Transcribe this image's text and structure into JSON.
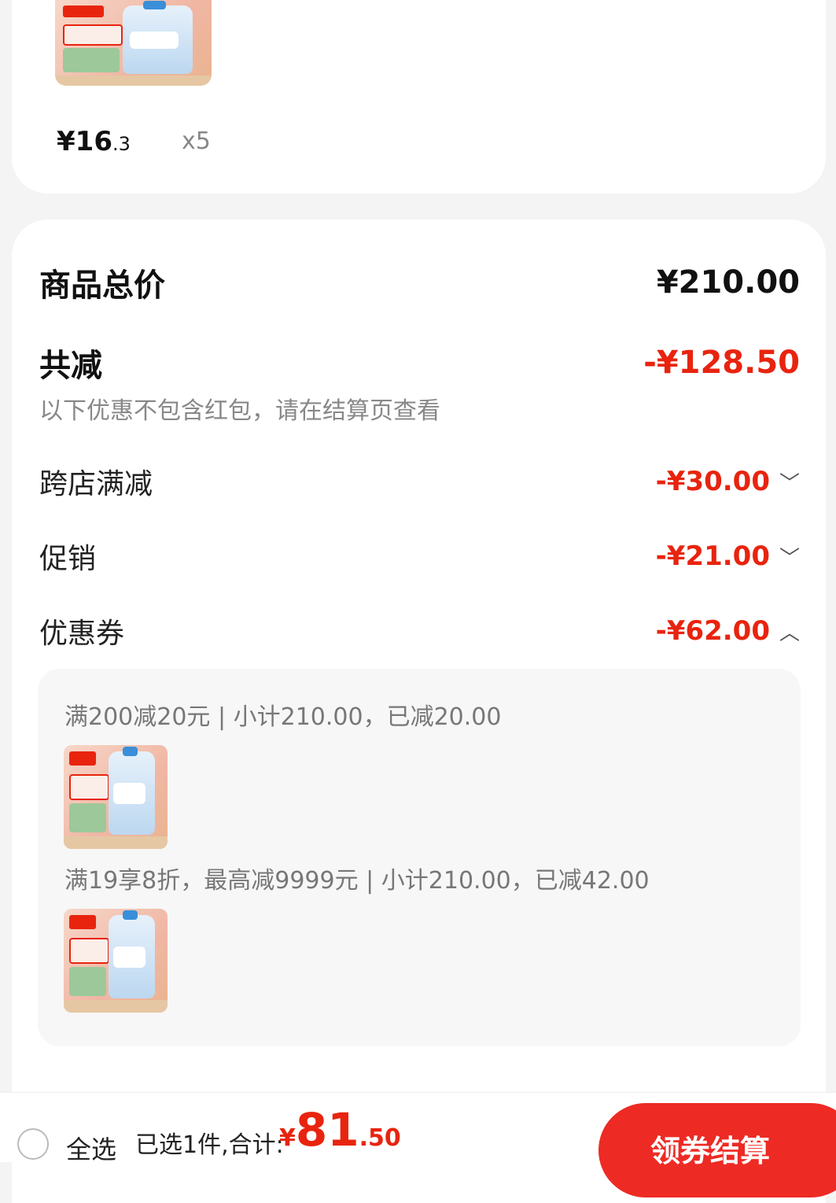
{
  "top_item": {
    "price_int": "¥16",
    "price_dec": ".3",
    "quantity": "x5"
  },
  "summary": {
    "total_label": "商品总价",
    "total_value": "¥210.00",
    "discount_label": "共减",
    "discount_value": "-¥128.50",
    "note": "以下优惠不包含红包，请在结算页查看",
    "items": [
      {
        "label": "跨店满减",
        "value": "-¥30.00",
        "chevron": "chevron-down-icon"
      },
      {
        "label": "促销",
        "value": "-¥21.00",
        "chevron": "chevron-down-icon"
      },
      {
        "label": "优惠券",
        "value": "-¥62.00",
        "chevron": "chevron-up-icon"
      }
    ]
  },
  "coupons": [
    {
      "text": "满200减20元 | 小计210.00，已减20.00"
    },
    {
      "text": "满19享8折，最高减9999元 | 小计210.00，已减42.00"
    }
  ],
  "bottom_bar": {
    "select_all": "全选",
    "selected_summary": "已选1件,合计:",
    "total_currency": "¥",
    "total_int": "81",
    "total_dec": ".50",
    "checkout": "领券结算"
  },
  "colors": {
    "accent": "#e8240f",
    "checkout_bg": "#ee2a24",
    "background": "#f4f4f4"
  }
}
